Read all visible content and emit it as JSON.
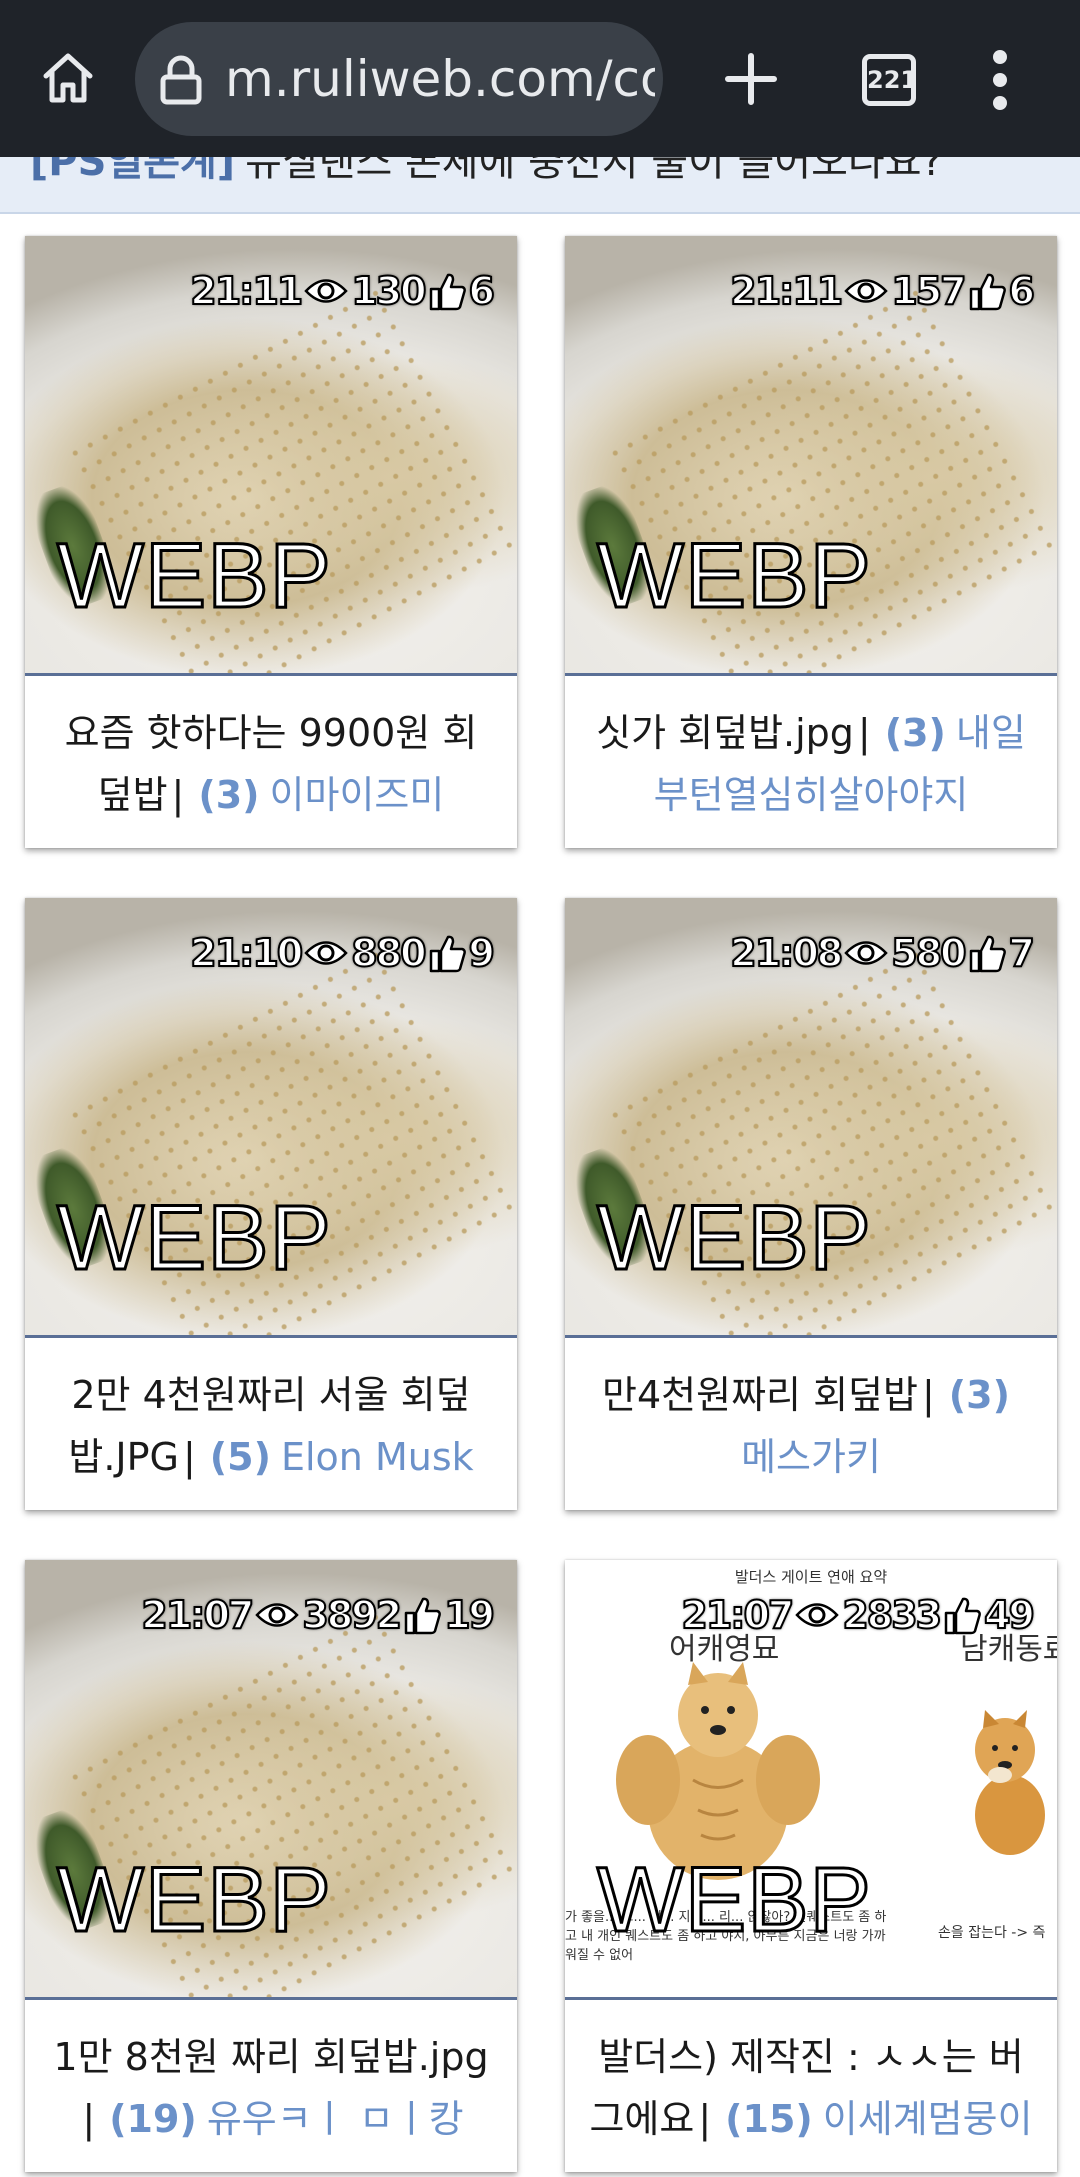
{
  "browser": {
    "url": "m.ruliweb.com/cor",
    "tab_count": "221",
    "icons": [
      "home-icon",
      "lock-icon",
      "plus-icon",
      "tabs-icon",
      "more-icon"
    ]
  },
  "notice": {
    "tag": "[PS일본계]",
    "text": "뉴질랜스 본체에 충전지 불이 들어오나요?"
  },
  "thumb_label": "WEBP",
  "cards": [
    {
      "time": "21:11",
      "views": "130",
      "likes": "6",
      "title": "요즘 핫하다는 9900원 회덮밥",
      "comments": "(3)",
      "author": "이마이즈미"
    },
    {
      "time": "21:11",
      "views": "157",
      "likes": "6",
      "title": "싯가 회덮밥.jpg",
      "comments": "(3)",
      "author": "내일부턴열심히살아야지"
    },
    {
      "time": "21:10",
      "views": "880",
      "likes": "9",
      "title": "2만 4천원짜리 서울 회덮밥.JPG",
      "comments": "(5)",
      "author": "Elon Musk"
    },
    {
      "time": "21:08",
      "views": "580",
      "likes": "7",
      "title": "만4천원짜리 회덮밥",
      "comments": "(3)",
      "author": "메스가키"
    },
    {
      "time": "21:07",
      "views": "3892",
      "likes": "19",
      "title": "1만 8천원 짜리 회덮밥.jpg",
      "comments": "(19)",
      "author": "유우ㅋㅣ ㅁㅣ캉"
    },
    {
      "time": "21:07",
      "views": "2833",
      "likes": "49",
      "title": "발더스) 제작진 : ㅅㅅ는 버그에요",
      "comments": "(15)",
      "author": "이세계멈뭉이"
    }
  ],
  "meme": {
    "title": "발더스 게이트 연애 요약",
    "label_left": "어캐영묘",
    "label_right": "남캐동료",
    "caption_left": "가 좋을... 그... 전... 지만... 리... 않잖아? 인퀘스트도 좀 하고 내 개인 퀘스트도 좀 하고 야지, 아무튼 지금은 너랑 가까워질 수 없어",
    "caption_right": "손을 잡는다 -> 즉"
  }
}
